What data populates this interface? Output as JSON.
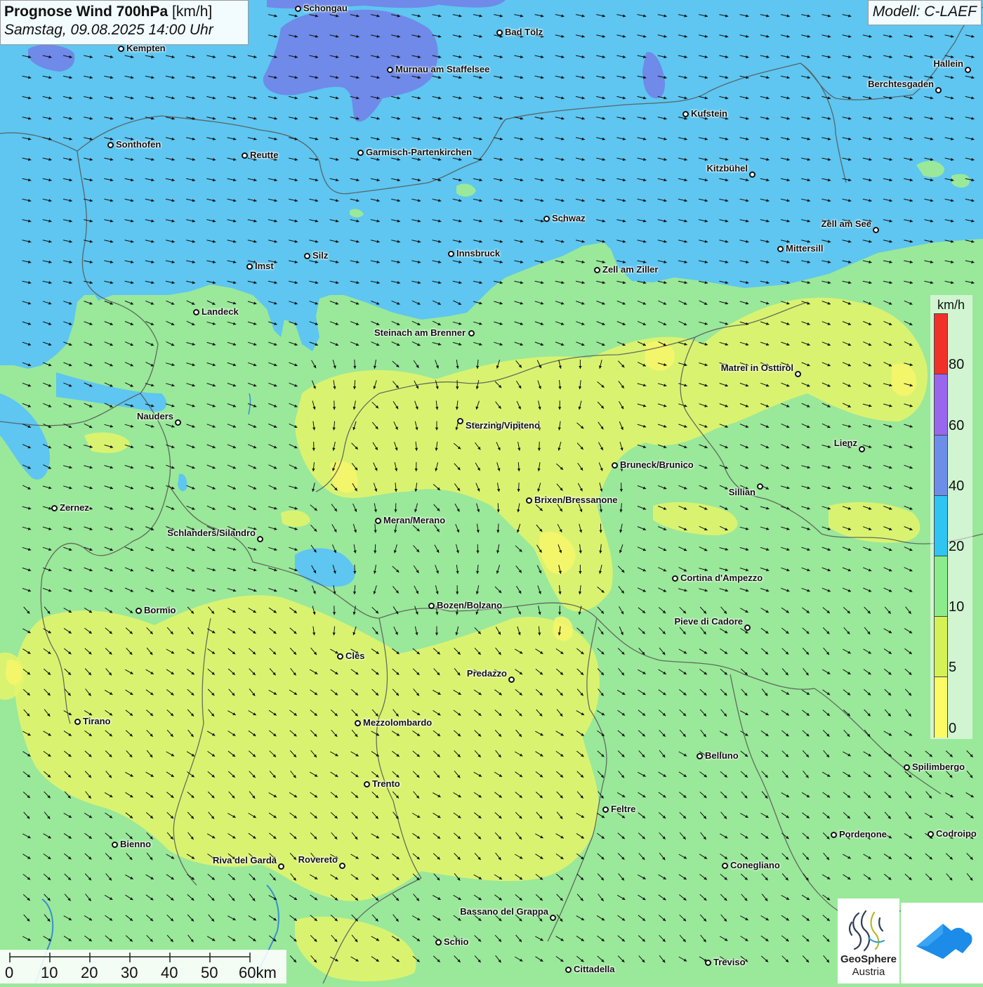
{
  "title": {
    "bold": "Prognose Wind 700hPa",
    "unit": "[km/h]",
    "date": "Samstag, 09.08.2025 14:00 Uhr"
  },
  "model": "Modell: C-LAEF",
  "legend": {
    "title": "km/h",
    "labels": [
      "80",
      "60",
      "40",
      "20",
      "10",
      "5",
      "0"
    ],
    "colors": [
      "#f2302a",
      "#9966ee",
      "#6d8ee8",
      "#2ec5f2",
      "#8cec8c",
      "#d4f255",
      "#fbfb66"
    ]
  },
  "scale": {
    "labels": [
      "0",
      "10",
      "20",
      "30",
      "40",
      "50",
      "60km"
    ]
  },
  "logo": {
    "line1": "GeoSphere",
    "line2": "Austria"
  },
  "colors": {
    "blue_high": "#5ec6f0",
    "blue_strong": "#6f8ae8",
    "green": "#99e899",
    "yellow": "#e4f46a",
    "border": "#555555",
    "arrow": "#111111"
  },
  "cities": [
    {
      "name": "Schongau",
      "icon": "city-dot"
    },
    {
      "name": "Bad Tölz",
      "icon": "city-dot"
    },
    {
      "name": "Kempten",
      "icon": "city-dot"
    },
    {
      "name": "Murnau am Staffelsee",
      "icon": "city-dot"
    },
    {
      "name": "Hallein",
      "icon": "city-dot"
    },
    {
      "name": "Berchtesgaden",
      "icon": "city-dot"
    },
    {
      "name": "Kufstein",
      "icon": "city-dot"
    },
    {
      "name": "Sonthofen",
      "icon": "city-dot"
    },
    {
      "name": "Reutte",
      "icon": "city-dot"
    },
    {
      "name": "Garmisch-Partenkirchen",
      "icon": "city-dot"
    },
    {
      "name": "Kitzbühel",
      "icon": "city-dot"
    },
    {
      "name": "Schwaz",
      "icon": "city-dot"
    },
    {
      "name": "Zell am See",
      "icon": "city-dot"
    },
    {
      "name": "Mittersill",
      "icon": "city-dot"
    },
    {
      "name": "Innsbruck",
      "icon": "city-dot"
    },
    {
      "name": "Silz",
      "icon": "city-dot"
    },
    {
      "name": "Imst",
      "icon": "city-dot"
    },
    {
      "name": "Zell am Ziller",
      "icon": "city-dot"
    },
    {
      "name": "Landeck",
      "icon": "city-dot"
    },
    {
      "name": "Steinach am Brenner",
      "icon": "city-dot"
    },
    {
      "name": "Matrei in Osttirol",
      "icon": "city-dot"
    },
    {
      "name": "Nauders",
      "icon": "city-dot"
    },
    {
      "name": "Sterzing/Vipiteno",
      "icon": "city-dot"
    },
    {
      "name": "Lienz",
      "icon": "city-dot"
    },
    {
      "name": "Bruneck/Brunico",
      "icon": "city-dot"
    },
    {
      "name": "Sillian",
      "icon": "city-dot"
    },
    {
      "name": "Brixen/Bressanone",
      "icon": "city-dot"
    },
    {
      "name": "Zernez",
      "icon": "city-dot"
    },
    {
      "name": "Meran/Merano",
      "icon": "city-dot"
    },
    {
      "name": "Schlanders/Silandro",
      "icon": "city-dot"
    },
    {
      "name": "Cortina d'Ampezzo",
      "icon": "city-dot"
    },
    {
      "name": "Bozen/Bolzano",
      "icon": "city-dot"
    },
    {
      "name": "Bormio",
      "icon": "city-dot"
    },
    {
      "name": "Pieve di Cadore",
      "icon": "city-dot"
    },
    {
      "name": "Cles",
      "icon": "city-dot"
    },
    {
      "name": "Predazzo",
      "icon": "city-dot"
    },
    {
      "name": "Tirano",
      "icon": "city-dot"
    },
    {
      "name": "Mezzolombardo",
      "icon": "city-dot"
    },
    {
      "name": "Belluno",
      "icon": "city-dot"
    },
    {
      "name": "Spilimbergo",
      "icon": "city-dot"
    },
    {
      "name": "Trento",
      "icon": "city-dot"
    },
    {
      "name": "Feltre",
      "icon": "city-dot"
    },
    {
      "name": "Pordenone",
      "icon": "city-dot"
    },
    {
      "name": "Codroipo",
      "icon": "city-dot"
    },
    {
      "name": "Bienno",
      "icon": "city-dot"
    },
    {
      "name": "Riva del Garda",
      "icon": "city-dot"
    },
    {
      "name": "Rovereto",
      "icon": "city-dot"
    },
    {
      "name": "Conegliano",
      "icon": "city-dot"
    },
    {
      "name": "Bassano del Grappa",
      "icon": "city-dot"
    },
    {
      "name": "Schio",
      "icon": "city-dot"
    },
    {
      "name": "Treviso",
      "icon": "city-dot"
    },
    {
      "name": "Cittadella",
      "icon": "city-dot"
    }
  ]
}
